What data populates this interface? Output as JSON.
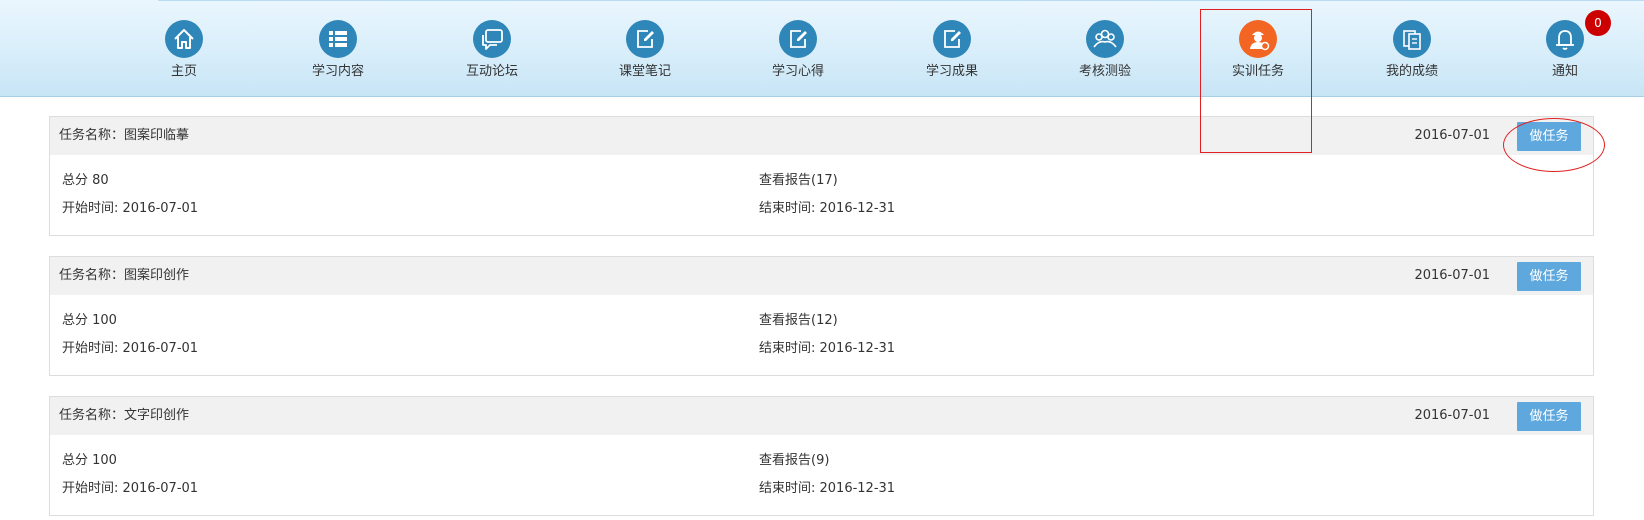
{
  "nav": {
    "items": [
      {
        "label": "主页",
        "icon": "home-icon"
      },
      {
        "label": "学习内容",
        "icon": "list-icon"
      },
      {
        "label": "互动论坛",
        "icon": "chat-bubble-icon"
      },
      {
        "label": "课堂笔记",
        "icon": "edit-note-icon"
      },
      {
        "label": "学习心得",
        "icon": "edit-note-icon"
      },
      {
        "label": "学习成果",
        "icon": "edit-note-icon"
      },
      {
        "label": "考核测验",
        "icon": "group-icon"
      },
      {
        "label": "实训任务",
        "icon": "trainee-icon",
        "active": true
      },
      {
        "label": "我的成绩",
        "icon": "grades-icon"
      },
      {
        "label": "通知",
        "icon": "bell-icon"
      }
    ],
    "notification_count": "0",
    "colors": {
      "icon_bg": "#2f86b8",
      "active_icon_bg": "#f26522",
      "badge": "#cc0000"
    }
  },
  "tasks": [
    {
      "name_prefix": "任务名称：",
      "name": "图案印临摹",
      "date": "2016-07-01",
      "button": "做任务",
      "score": "总分 80",
      "report": "查看报告(17)",
      "start": "开始时间: 2016-07-01",
      "end": "结束时间: 2016-12-31"
    },
    {
      "name_prefix": "任务名称：",
      "name": "图案印创作",
      "date": "2016-07-01",
      "button": "做任务",
      "score": "总分 100",
      "report": "查看报告(12)",
      "start": "开始时间: 2016-07-01",
      "end": "结束时间: 2016-12-31"
    },
    {
      "name_prefix": "任务名称：",
      "name": "文字印创作",
      "date": "2016-07-01",
      "button": "做任务",
      "score": "总分 100",
      "report": "查看报告(9)",
      "start": "开始时间: 2016-07-01",
      "end": "结束时间: 2016-12-31"
    }
  ],
  "colors": {
    "button": "#5fa8de",
    "annotation": "#e02020"
  }
}
